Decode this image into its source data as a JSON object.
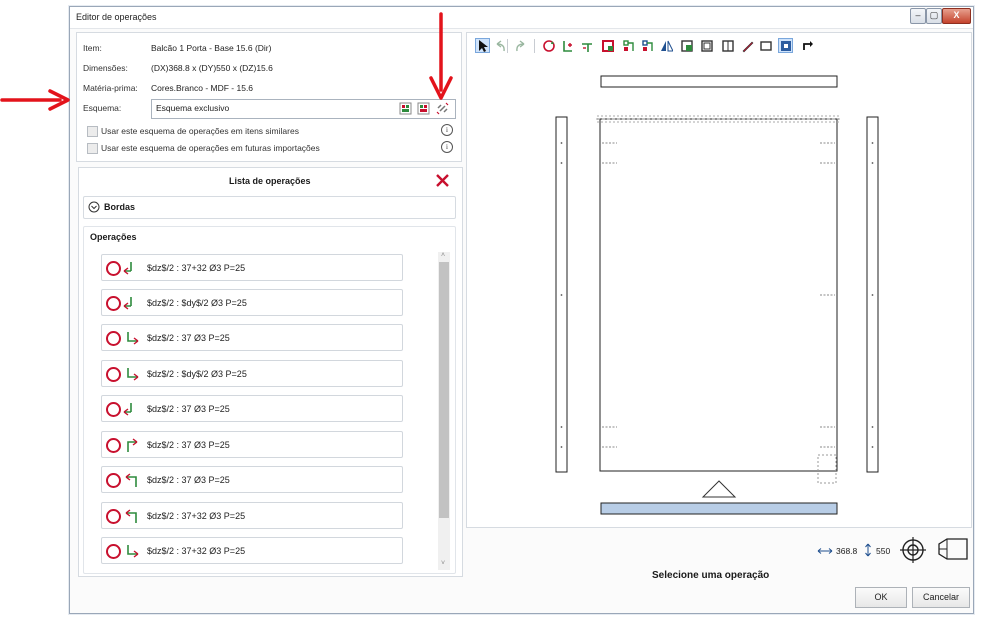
{
  "window": {
    "title": "Editor de operações",
    "controls": [
      "–",
      "▢",
      "X"
    ]
  },
  "info": {
    "item_label": "Item:",
    "item_value": "Balcão 1 Porta - Base 15.6 (Dir)",
    "dim_label": "Dimensões:",
    "dim_value": "(DX)368.8 x (DY)550 x (DZ)15.6",
    "mat_label": "Matéria-prima:",
    "mat_value": "Cores.Branco - MDF - 15.6",
    "esq_label": "Esquema:",
    "esq_value": "Esquema exclusivo",
    "check1": "Usar este esquema de operações em itens similares",
    "check2": "Usar este esquema de operações em futuras importações",
    "info_glyph": "i"
  },
  "list": {
    "title": "Lista de operações",
    "bordas": "Bordas",
    "operacoes": "Operações",
    "items": [
      "$dz$/2 : 37+32 Ø3 P=25",
      "$dz$/2 : $dy$/2 Ø3 P=25",
      "$dz$/2 : 37 Ø3 P=25",
      "$dz$/2 : $dy$/2 Ø3 P=25",
      "$dz$/2 : 37 Ø3 P=25",
      "$dz$/2 : 37 Ø3 P=25",
      "$dz$/2 : 37 Ø3 P=25",
      "$dz$/2 : 37+32 Ø3 P=25",
      "$dz$/2 : 37+32 Ø3 P=25"
    ]
  },
  "toolbar": {
    "tools": [
      "pointer-icon",
      "undo-icon",
      "redo-icon",
      "rotate-icon",
      "add-op-icon",
      "edge-op-icon",
      "rect-op-icon",
      "drill-group-icon",
      "drill-group2-icon",
      "mirror-icon",
      "add-piece-icon",
      "frame-icon",
      "window-icon",
      "pencil-icon",
      "rect-outline-icon",
      "fit-icon",
      "rotate-corner-icon"
    ]
  },
  "canvas": {
    "dx": "368.8",
    "dy": "550",
    "status": "Selecione uma operação"
  },
  "buttons": {
    "ok": "OK",
    "cancel": "Cancelar"
  },
  "colors": {
    "accent": "#c8102e",
    "selection": "#cfe3fb",
    "piece_fill": "#b8cde6",
    "arrow": "#e3131b"
  }
}
